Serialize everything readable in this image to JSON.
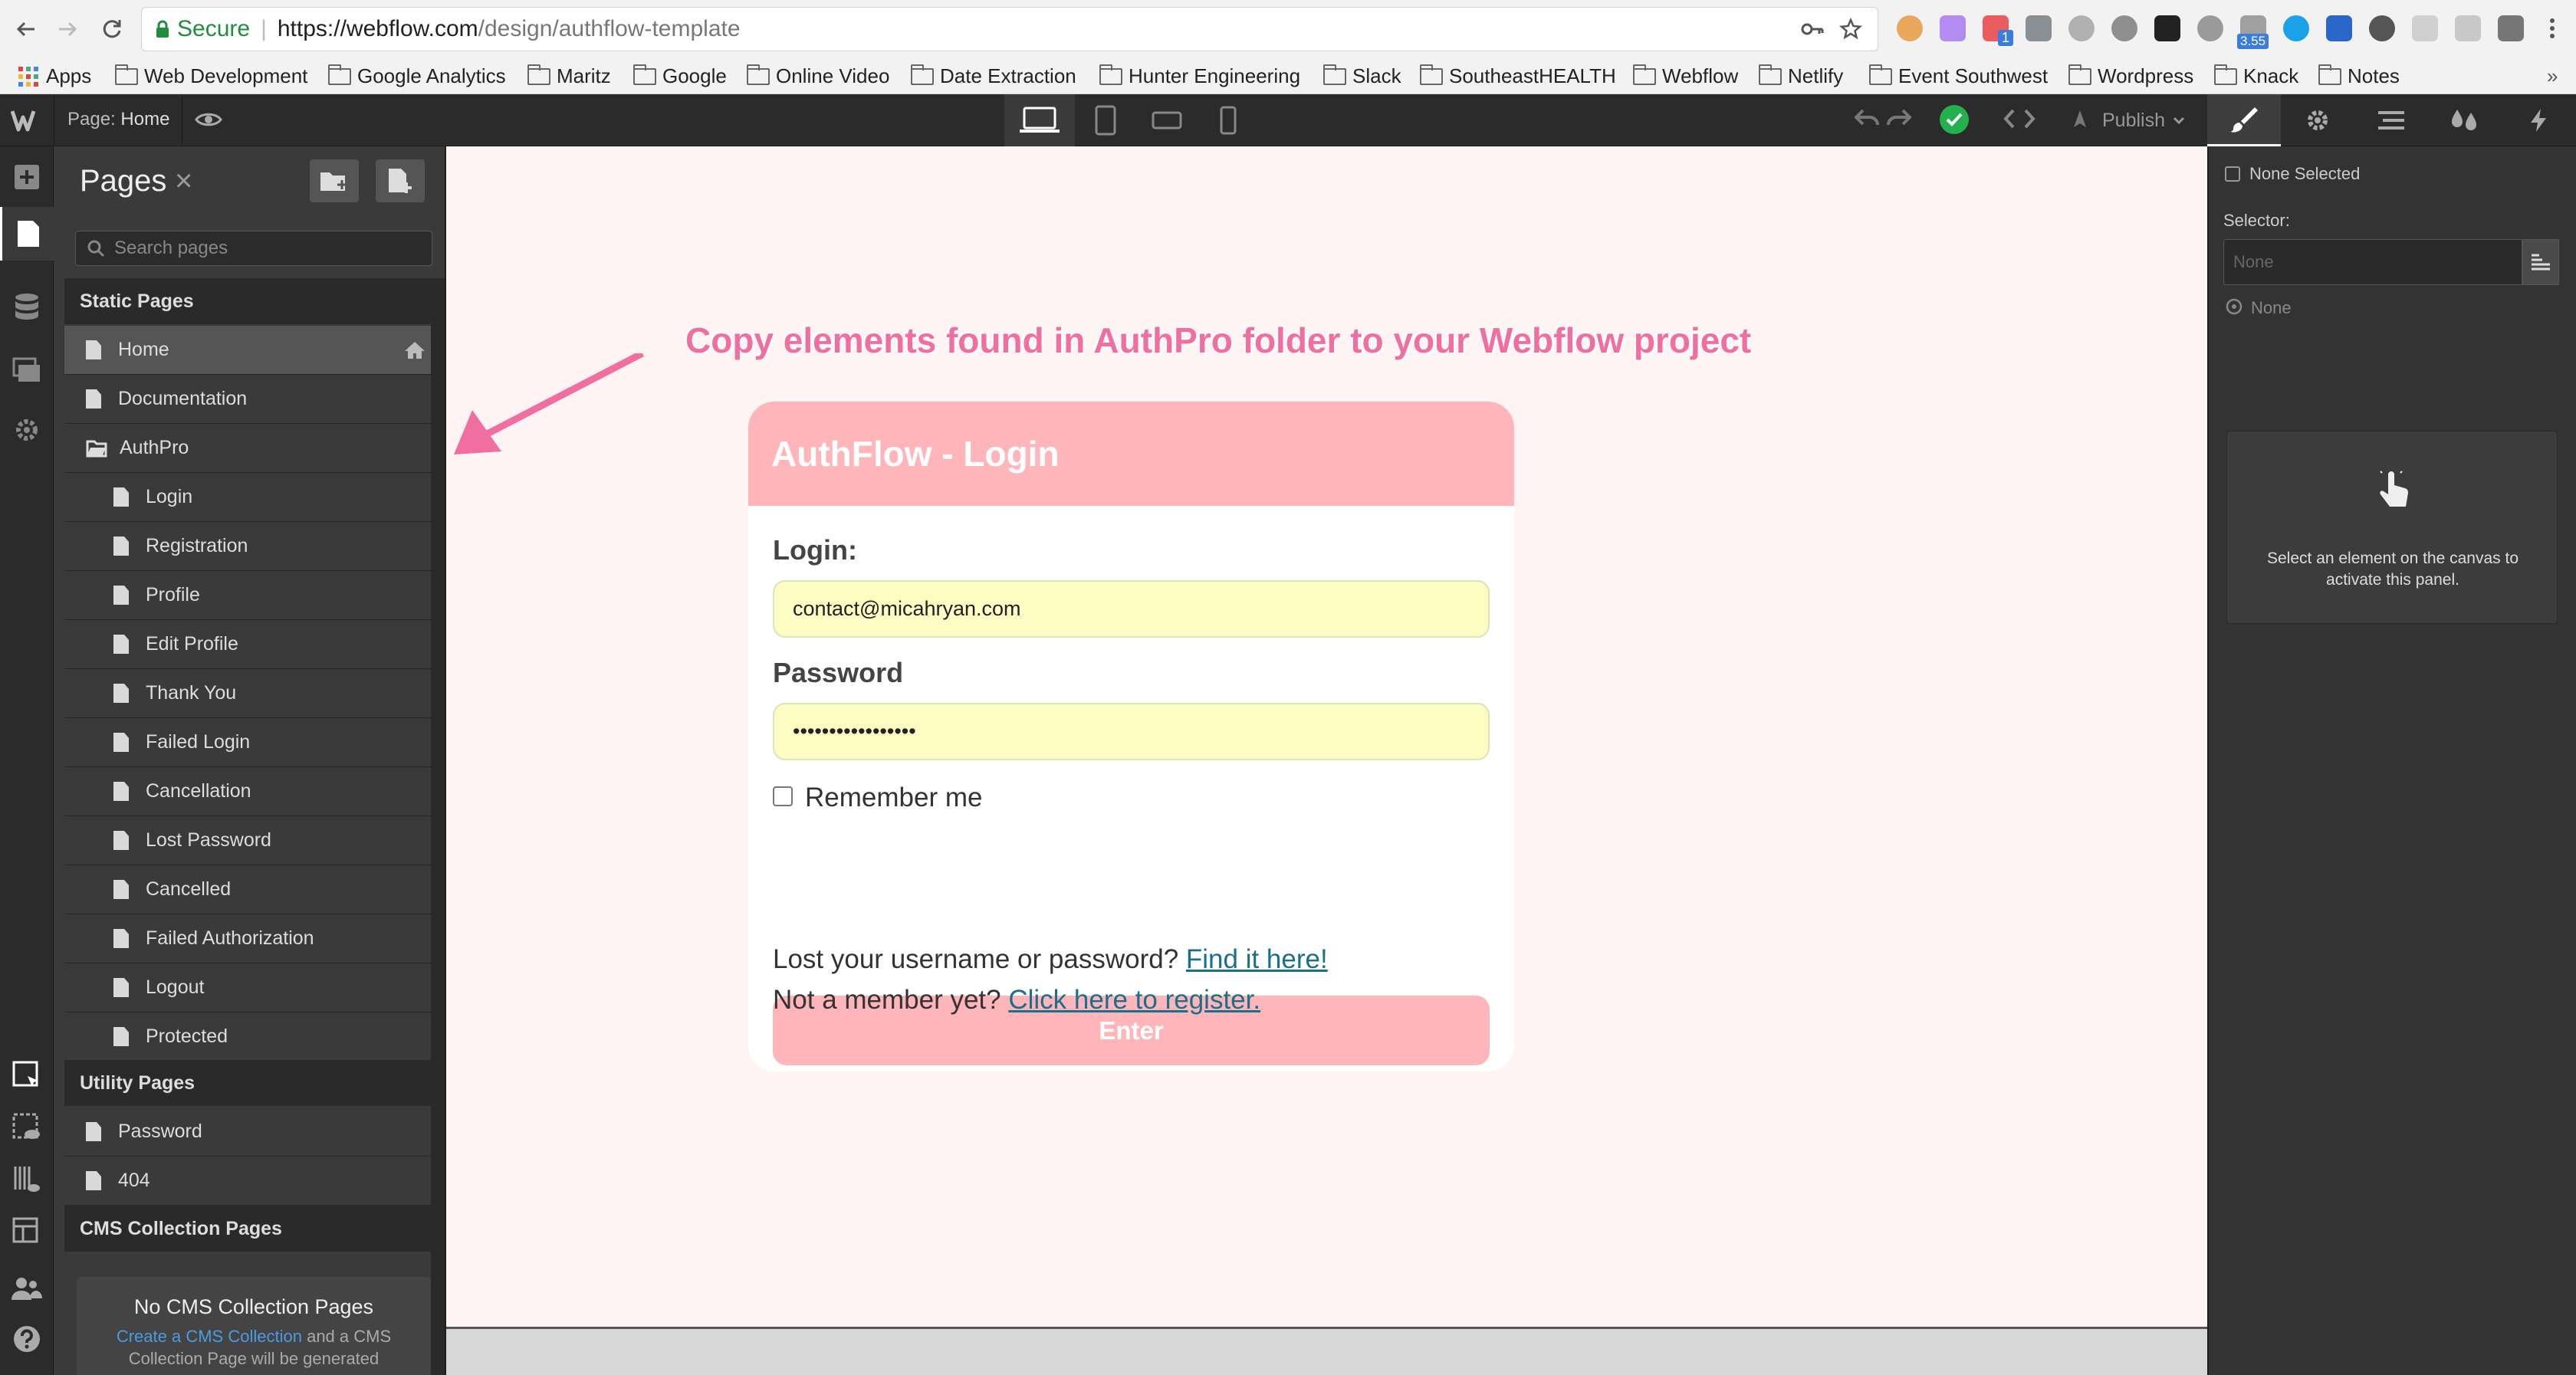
{
  "browser": {
    "secure_label": "Secure",
    "url_host": "https://webflow.com",
    "url_path": "/design/authflow-template",
    "ext_badge_1": "1",
    "ext_badge_2": "3.55",
    "bookmarks": [
      "Apps",
      "Web Development",
      "Google Analytics",
      "Maritz",
      "Google",
      "Online Video",
      "Date Extraction",
      "Hunter Engineering",
      "Slack",
      "SoutheastHEALTH",
      "Webflow",
      "Netlify",
      "Event Southwest",
      "Wordpress",
      "Knack",
      "Notes"
    ],
    "bookmarks_overflow": "»"
  },
  "topbar": {
    "page_prefix": "Page:",
    "page_name": "Home",
    "publish_label": "Publish"
  },
  "pages_panel": {
    "title": "Pages",
    "close_glyph": "×",
    "search_placeholder": "Search pages",
    "static_header": "Static Pages",
    "static_pages": [
      "Home",
      "Documentation",
      "AuthPro",
      "Login",
      "Registration",
      "Profile",
      "Edit Profile",
      "Thank You",
      "Failed Login",
      "Cancellation",
      "Lost Password",
      "Cancelled",
      "Failed Authorization",
      "Logout",
      "Protected"
    ],
    "utility_header": "Utility Pages",
    "utility_pages": [
      "Password",
      "404"
    ],
    "cms_header": "CMS Collection Pages",
    "cms_empty_title": "No CMS Collection Pages",
    "cms_link": "Create a CMS Collection",
    "cms_text_1": "and a CMS",
    "cms_text_2": "Collection Page will be generated"
  },
  "canvas": {
    "annotation": "Copy elements found in AuthPro folder to your Webflow project",
    "card_title": "AuthFlow - Login",
    "login_label": "Login:",
    "login_value": "contact@micahryan.com",
    "password_label": "Password",
    "password_value": "•••••••••••••••••",
    "remember_label": "Remember me",
    "enter_label": "Enter",
    "lost_text": "Lost your username or password?",
    "lost_link": "Find it here!",
    "member_text": "Not a member yet?",
    "member_link": "Click here to register."
  },
  "right_panel": {
    "none_selected": "None Selected",
    "selector_label": "Selector:",
    "selector_placeholder": "None",
    "state_label": "None",
    "hint": "Select an element on the canvas to activate this panel."
  },
  "colors": {
    "accent_pink": "#ffb6bb",
    "annotation_pink": "#f06ea0",
    "link_teal": "#1a6f8a",
    "status_green": "#22b14c"
  }
}
